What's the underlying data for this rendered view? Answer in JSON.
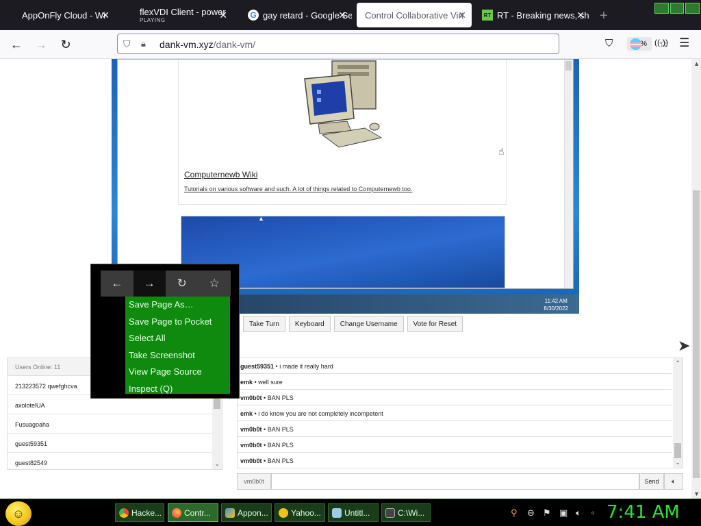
{
  "tabs": [
    {
      "title": "AppOnFly Cloud - Wi",
      "active": false
    },
    {
      "title": "flexVDI Client - power",
      "subtitle": "PLAYING",
      "active": false
    },
    {
      "title": "gay retard - Google Se",
      "active": false
    },
    {
      "title": "Control Collaborative Virt",
      "active": true
    },
    {
      "title": "RT - Breaking news, sh",
      "active": false
    }
  ],
  "tab_close_glyph": "✕",
  "new_tab_glyph": "+",
  "nav": {
    "back": "←",
    "forward": "→",
    "reload": "↻",
    "url_host": "dank-vm.xyz",
    "url_path": "/dank-vm/",
    "zoom": "67%"
  },
  "vm": {
    "card_title": "Computernewb Wiki",
    "card_desc": "Tutorials on various software and such. A lot of things related to Computernewb too.",
    "clock_time": "11:42 AM",
    "clock_date": "8/30/2022"
  },
  "controls": {
    "take_turn": "Take Turn",
    "keyboard": "Keyboard",
    "change_username": "Change Username",
    "vote_reset": "Vote for Reset"
  },
  "users": {
    "header": "Users Online: 11",
    "list": [
      "213223572 qwefghcva",
      "axolotelUA",
      "Fusuagoaha",
      "guest59351",
      "guest82549"
    ]
  },
  "chat": {
    "messages": [
      {
        "user": "guest59351",
        "text": "i made it really hard"
      },
      {
        "user": "emk",
        "text": "well sure"
      },
      {
        "user": "vm0b0t",
        "text": "BAN PLS"
      },
      {
        "user": "emk",
        "text": "i do know you are not completely incompetent"
      },
      {
        "user": "vm0b0t",
        "text": "BAN PLS"
      },
      {
        "user": "vm0b0t",
        "text": "BAN PLS"
      },
      {
        "user": "vm0b0t",
        "text": "BAN PLS"
      }
    ],
    "separator": "•",
    "username": "vm0b0t",
    "input_value": "",
    "send_label": "Send"
  },
  "context_menu": {
    "items": [
      "Save Page As…",
      "Save Page to Pocket",
      "Select All",
      "Take Screenshot",
      "View Page Source",
      "Inspect (Q)"
    ]
  },
  "taskbar": {
    "items": [
      {
        "label": "Hacke...",
        "color": "#e8453c"
      },
      {
        "label": "Contr...",
        "color": "#ff7139",
        "active": true
      },
      {
        "label": "Appon...",
        "color": "#4a90d9"
      },
      {
        "label": "Yahoo...",
        "color": "#f2c31a"
      },
      {
        "label": "Untitl...",
        "color": "#9ccce8"
      },
      {
        "label": "C:\\Wi...",
        "color": "#444444"
      }
    ],
    "clock": "7:41 AM"
  },
  "colors": {
    "accent_green": "#0f8a0f",
    "clock_green": "#2ee02e",
    "chrome_dark": "#1c1b22"
  }
}
